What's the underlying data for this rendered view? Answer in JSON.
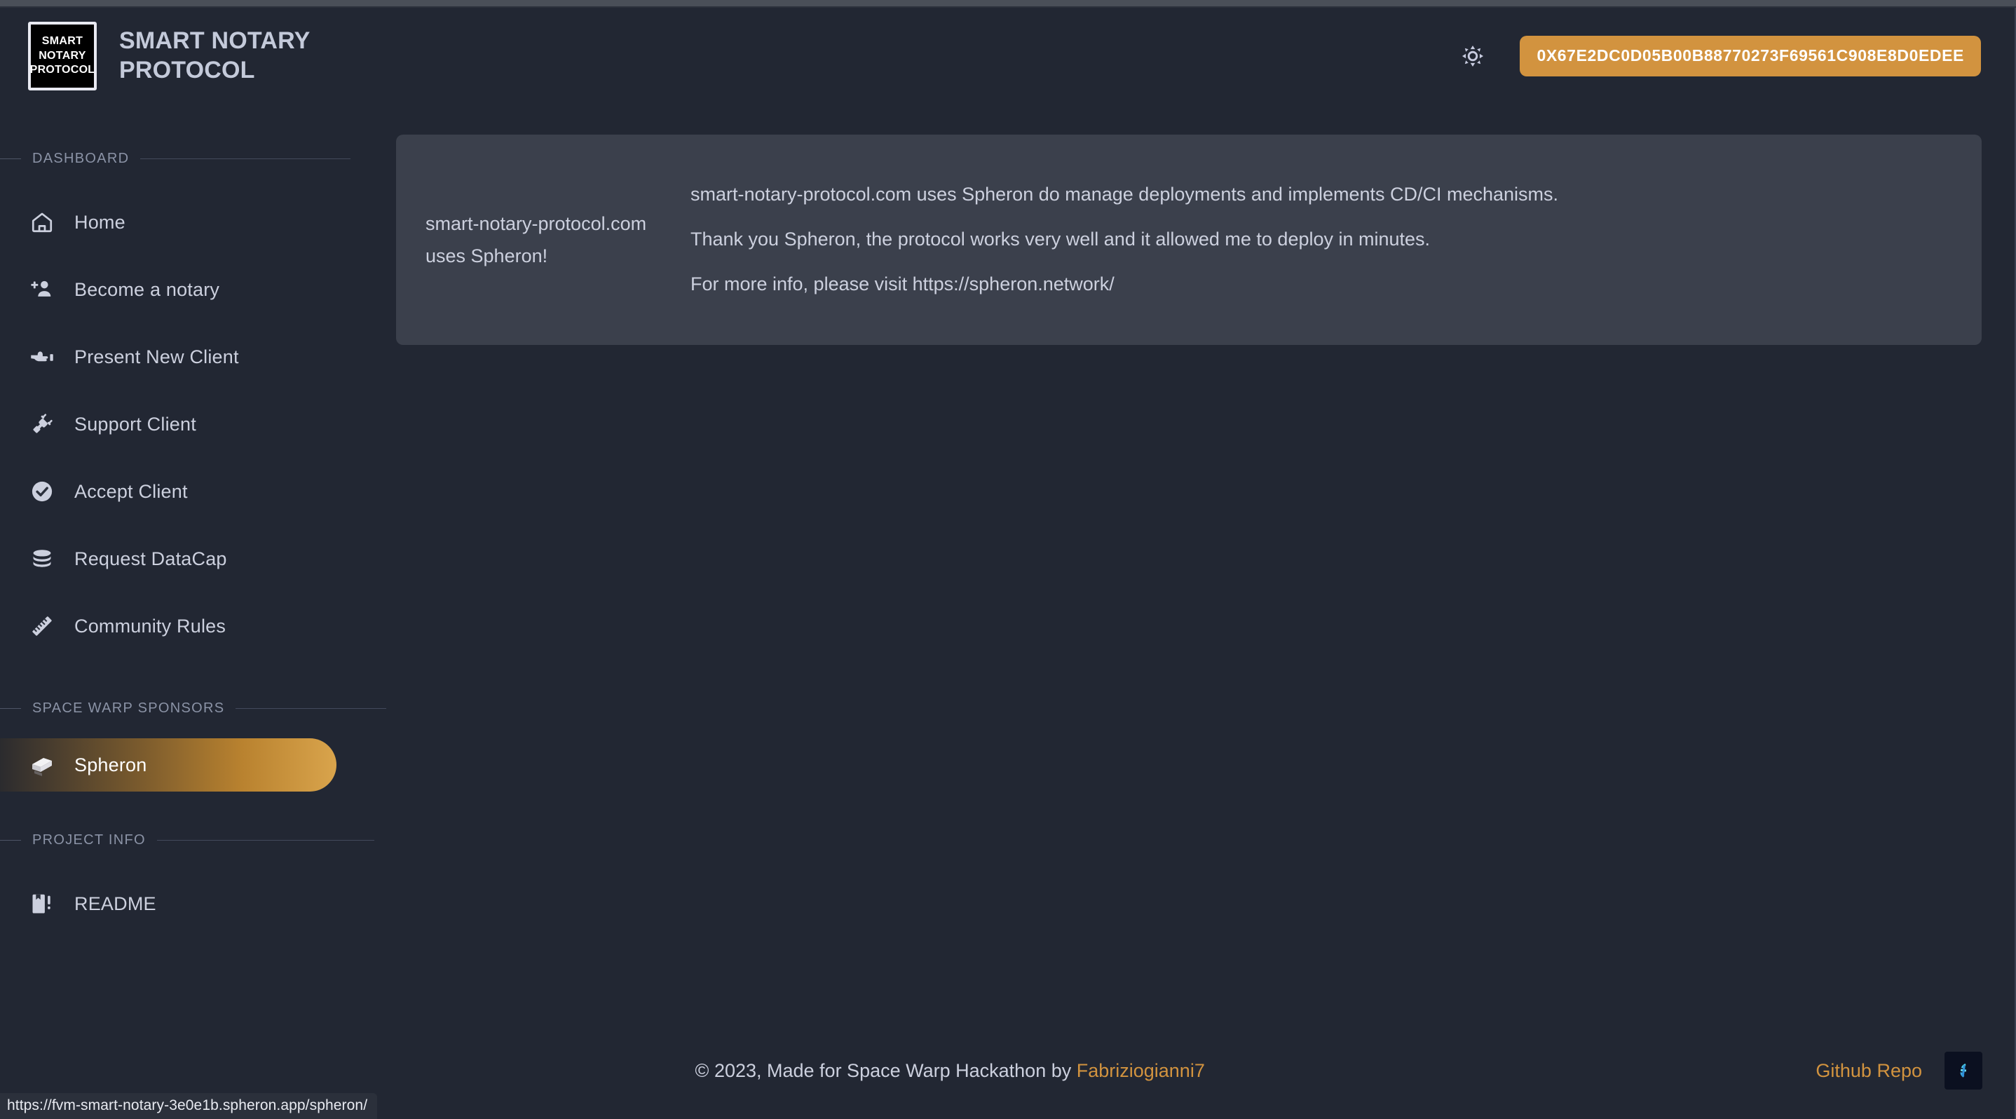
{
  "browser": {
    "status_url": "https://fvm-smart-notary-3e0e1b.spheron.app/spheron/"
  },
  "header": {
    "logo_lines": [
      "SMART",
      "NOTARY",
      "PROTOCOL"
    ],
    "title": "SMART NOTARY PROTOCOL",
    "theme_toggle_icon": "brightness-sun-icon",
    "wallet_address": "0X67E2DC0D05B00B88770273F69561C908E8D0EDEE"
  },
  "sidebar": {
    "sections": [
      {
        "label": "DASHBOARD",
        "items": [
          {
            "label": "Home",
            "icon": "home-icon",
            "active": false
          },
          {
            "label": "Become a notary",
            "icon": "person-add-icon",
            "active": false
          },
          {
            "label": "Present New Client",
            "icon": "pointing-hand-icon",
            "active": false
          },
          {
            "label": "Support Client",
            "icon": "plug-connect-icon",
            "active": false
          },
          {
            "label": "Accept Client",
            "icon": "check-circle-icon",
            "active": false
          },
          {
            "label": "Request DataCap",
            "icon": "database-stack-icon",
            "active": false
          },
          {
            "label": "Community Rules",
            "icon": "ruler-icon",
            "active": false
          }
        ]
      },
      {
        "label": "SPACE WARP SPONSORS",
        "items": [
          {
            "label": "Spheron",
            "icon": "spheron-logo-icon",
            "active": true
          }
        ]
      },
      {
        "label": "PROJECT INFO",
        "items": [
          {
            "label": "README",
            "icon": "book-alert-icon",
            "active": false
          }
        ]
      }
    ]
  },
  "main": {
    "card": {
      "heading": "smart-notary-protocol.com uses Spheron!",
      "paragraphs": [
        "smart-notary-protocol.com uses Spheron do manage deployments and implements CD/CI mechanisms.",
        "Thank you Spheron, the protocol works very well and it allowed me to deploy in minutes.",
        "For more info, please visit https://spheron.network/"
      ]
    }
  },
  "footer": {
    "copyright_prefix": "© 2023, Made for Space Warp Hackathon by ",
    "author": "Fabriziogianni7",
    "repo_label": "Github Repo",
    "badge_icon": "filecoin-logo-icon"
  },
  "colors": {
    "page_background": "#222733",
    "card_background": "#3b404c",
    "accent_orange": "#d2933f",
    "text_primary": "#ccd0de",
    "text_muted": "#8b93a6"
  }
}
